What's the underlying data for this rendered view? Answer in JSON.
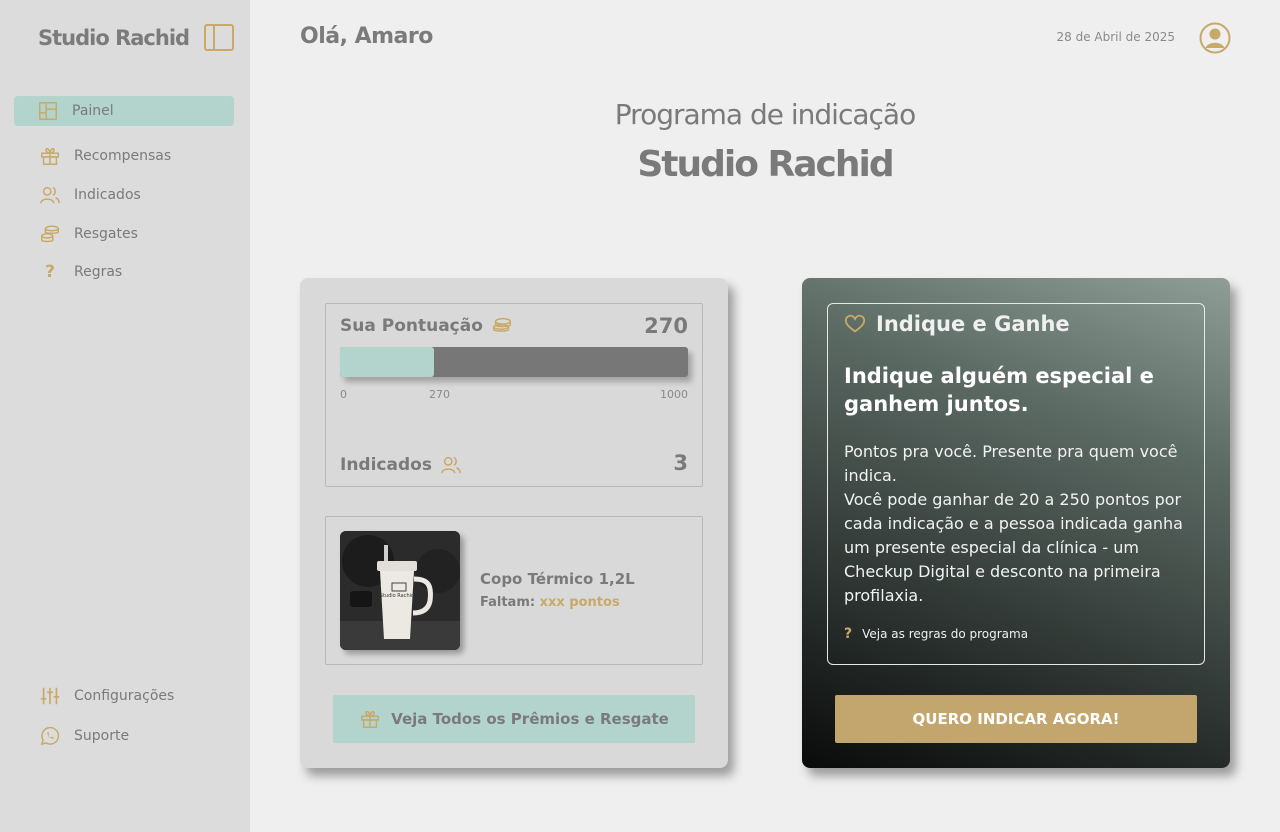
{
  "sidebar": {
    "brand": "Studio Rachid",
    "items": [
      {
        "label": "Painel",
        "icon": "panel-icon",
        "active": true
      },
      {
        "label": "Recompensas",
        "icon": "gift-icon"
      },
      {
        "label": "Indicados",
        "icon": "users-icon"
      },
      {
        "label": "Resgates",
        "icon": "coins-icon"
      },
      {
        "label": "Regras",
        "icon": "?"
      }
    ],
    "footer": [
      {
        "label": "Configurações",
        "icon": "sliders-icon"
      },
      {
        "label": "Suporte",
        "icon": "whatsapp-icon"
      }
    ]
  },
  "header": {
    "greeting": "Olá, Amaro",
    "date": "28 de Abril de 2025"
  },
  "hero": {
    "title": "Programa de indicação",
    "brand": "Studio Rachid"
  },
  "score": {
    "label": "Sua Pontuação",
    "value": "270",
    "progress_fraction": 0.27,
    "ticks": {
      "min": "0",
      "current": "270",
      "max": "1000"
    },
    "referrals_label": "Indicados",
    "referrals_value": "3"
  },
  "reward": {
    "name": "Copo Térmico 1,2L",
    "need_label": "Faltam:",
    "need_value": "xxx pontos",
    "cup_text": "Studio Rachid"
  },
  "prizes_button": "Veja Todos os Prêmios e Resgate",
  "promo": {
    "title": "Indique e Ganhe",
    "headline": "Indique alguém especial e ganhem juntos.",
    "body_1": "Pontos pra você. Presente pra quem você indica.",
    "body_2": "Você pode ganhar de 20 a 250 pontos por cada indicação e a pessoa indicada ganha um presente especial da clínica - um Checkup Digital e desconto na primeira profilaxia.",
    "rules_link": "Veja as regras do programa",
    "cta": "QUERO INDICAR AGORA!"
  },
  "colors": {
    "accent_gold": "#c8a968",
    "accent_mint": "#b3d4cd",
    "sidebar_bg": "#dcdcdc",
    "page_bg": "#efefef"
  }
}
